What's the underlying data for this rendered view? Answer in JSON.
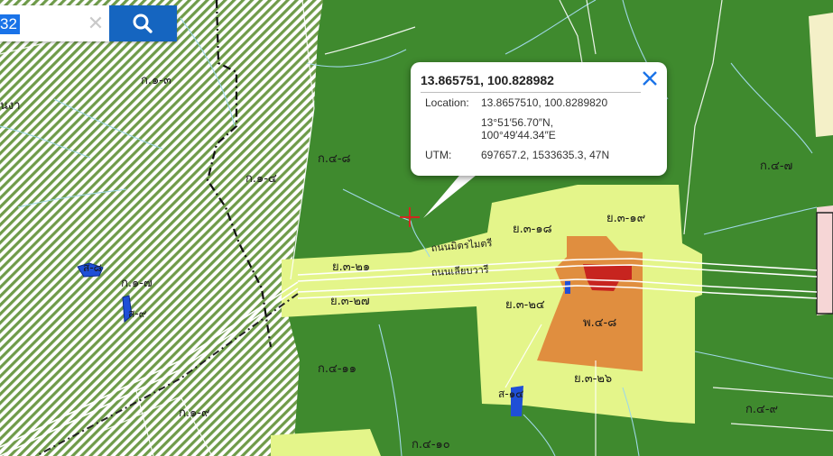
{
  "search": {
    "selected_text": "32",
    "clear_icon": "close-icon",
    "button_icon": "search-icon"
  },
  "popup": {
    "title": "13.865751, 100.828982",
    "close_icon": "close-icon",
    "location_label": "Location:",
    "location_value": "13.8657510, 100.8289820",
    "dms_lat": "13°51′56.70″N,",
    "dms_lon": "100°49′44.34″E",
    "utm_label": "UTM:",
    "utm_value": "697657.2, 1533635.3, 47N"
  },
  "marker_icon": "crosshair-marker-icon",
  "colors": {
    "agriculture": "#3f8a2e",
    "rural_agri": "#e4f58a",
    "commercial": "#e08e3f",
    "government": "#c7241f",
    "water": "#1f4fd6",
    "conservation_hatch": "#6f9b4a",
    "popup_close": "#1a73e8",
    "search_button": "#1565c0"
  },
  "map_labels": {
    "k_1_3": "ก.๑-๓",
    "k_1_4": "ก.๑-๔",
    "k_1_7": "ก.๑-๗",
    "k_1_9": "ก.๑-๙",
    "k_4_8": "ก.๔-๘",
    "k_4_7": "ก.๔-๗",
    "k_4_9": "ก.๔-๙",
    "k_4_10": "ก.๔-๑๐",
    "k_4_11": "ก.๔-๑๑",
    "y_3_18": "ย.๓-๑๘",
    "y_3_19": "ย.๓-๑๙",
    "y_3_21": "ย.๓-๒๑",
    "y_3_24": "ย.๓-๒๔",
    "y_3_26": "ย.๓-๒๖",
    "y_3_27": "ย.๓-๒๗",
    "p_4_8": "พ.๔-๘",
    "s_8": "ส-๘",
    "s_9": "ส-๙",
    "s_14": "ส-๑๔",
    "road_mitmaitri": "ถนนมิตรไมตรี",
    "road_liapwari": "ถนนเลียบวารี",
    "partial_left": "นงา"
  }
}
